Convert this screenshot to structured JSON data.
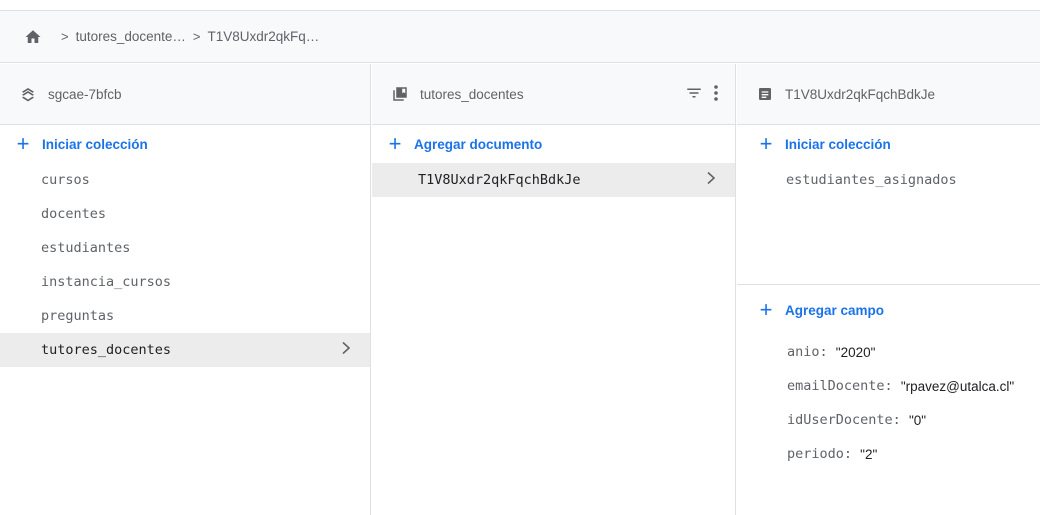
{
  "breadcrumb": {
    "segments": [
      "tutores_docente…",
      "T1V8Uxdr2qkFq…"
    ],
    "separator": ">"
  },
  "root_panel": {
    "title": "sgcae-7bfcb",
    "add_label": "Iniciar colección",
    "items": [
      "cursos",
      "docentes",
      "estudiantes",
      "instancia_cursos",
      "preguntas",
      "tutores_docentes"
    ],
    "selected_index": 5
  },
  "collection_panel": {
    "title": "tutores_docentes",
    "add_label": "Agregar documento",
    "items": [
      "T1V8Uxdr2qkFqchBdkJe"
    ],
    "selected_index": 0
  },
  "document_panel": {
    "title": "T1V8Uxdr2qkFqchBdkJe",
    "add_collection_label": "Iniciar colección",
    "subcollections": [
      "estudiantes_asignados"
    ],
    "add_field_label": "Agregar campo",
    "fields": [
      {
        "key": "anio",
        "value": "\"2020\""
      },
      {
        "key": "emailDocente",
        "value": "\"rpavez@utalca.cl\""
      },
      {
        "key": "idUserDocente",
        "value": "\"0\""
      },
      {
        "key": "periodo",
        "value": "\"2\""
      }
    ]
  },
  "colors": {
    "accent": "#1a73e8",
    "selected_bg": "#ececec",
    "header_bg": "#f8f9fa"
  },
  "icons": {
    "home": "home-icon",
    "project": "database-icon",
    "collection": "collection-icon",
    "document": "document-icon",
    "filter": "filter-icon",
    "more": "more-vert-icon",
    "chevron": "chevron-right-icon"
  }
}
